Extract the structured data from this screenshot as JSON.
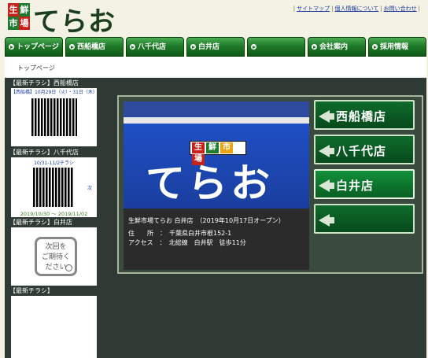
{
  "header": {
    "logo_chars": [
      "生",
      "鮮",
      "市",
      "場"
    ],
    "logo_text": "てらお",
    "links": [
      "サイトマップ",
      "個人情報について",
      "お問い合わせ"
    ]
  },
  "nav": {
    "items": [
      {
        "label": "トップページ"
      },
      {
        "label": "西船橋店"
      },
      {
        "label": "八千代店"
      },
      {
        "label": "白井店"
      },
      {
        "label": ""
      },
      {
        "label": "会社案内"
      },
      {
        "label": "採用情報"
      }
    ]
  },
  "breadcrumb": "トップページ",
  "sidebar": {
    "sections": [
      {
        "title": "【最新チラシ】西船橋店",
        "caption": "【西船橋】10月29日（火）・31日（木）"
      },
      {
        "title": "【最新チラシ】八千代店",
        "caption": "10/31-11/2チラシ",
        "side": "次",
        "date": "2019/10/30 ～ 2019/11/02"
      },
      {
        "title": "【最新チラシ】白井店",
        "coming_soon": [
          "次回を",
          "ご期待く",
          "ださい"
        ]
      },
      {
        "title": "【最新チラシ】"
      }
    ]
  },
  "hero": {
    "photo_sign_chars": [
      "生",
      "鮮",
      "市",
      "場"
    ],
    "photo_sign_text": "てらお",
    "caption_title": "生鮮市場てらお 白井店　（2019年10月17日オープン）",
    "address": "住　　所　：　千葉県白井市根152-1",
    "access": "アクセス　：　北総線　白井駅　徒歩11分"
  },
  "stores": [
    {
      "label": "西船橋店"
    },
    {
      "label": "八千代店"
    },
    {
      "label": "白井店"
    },
    {
      "label": ""
    }
  ],
  "colors": {
    "nav_green": "#1e7a28",
    "main_bg": "#2e3a33",
    "link_blue": "#1a3ca0",
    "sign_blue": "#1f4fc4"
  }
}
